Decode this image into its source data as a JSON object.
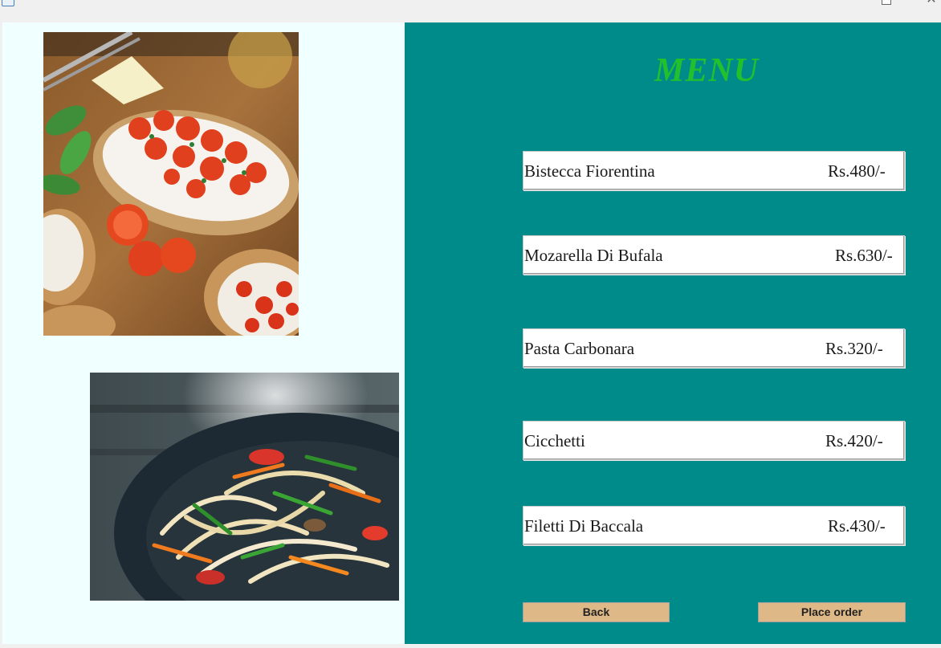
{
  "window": {
    "maximize_icon": "maximize-icon",
    "close_glyph": "✕"
  },
  "menu": {
    "title": "MENU",
    "title_color": "#22c02c",
    "items": [
      {
        "name": "Bistecca Fiorentina",
        "price": "Rs.480/-"
      },
      {
        "name": "Mozarella Di Bufala",
        "price": "Rs.630/-"
      },
      {
        "name": "Pasta Carbonara",
        "price": "Rs.320/-"
      },
      {
        "name": "Cicchetti",
        "price": "Rs.420/-"
      },
      {
        "name": "Filetti Di Baccala",
        "price": "Rs.430/-"
      }
    ]
  },
  "buttons": {
    "back": "Back",
    "place_order": "Place order"
  },
  "colors": {
    "left_panel_bg": "#f0ffff",
    "right_panel_bg": "#008b8b",
    "button_bg": "#deb887"
  }
}
